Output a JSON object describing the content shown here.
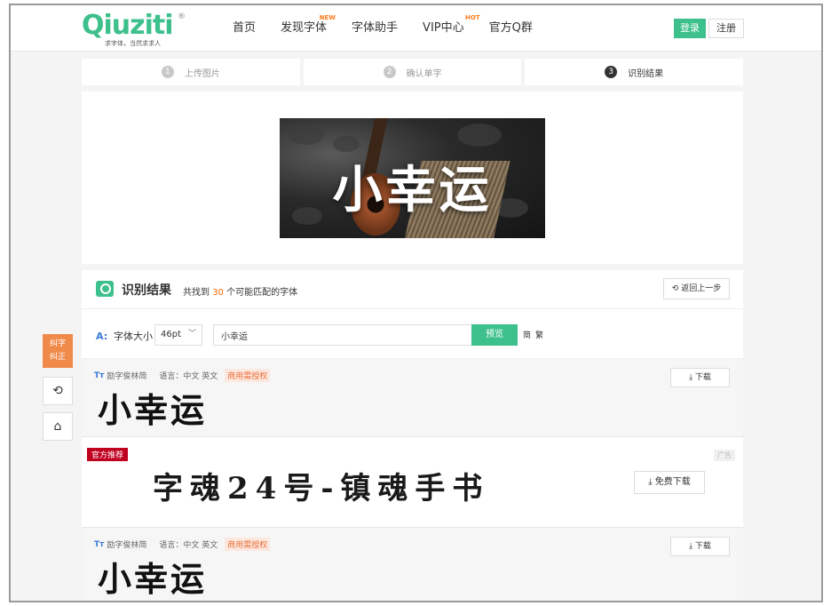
{
  "header": {
    "logo_text": "Qiuziti",
    "logo_reg": "®",
    "logo_slogan": "求字体，当然求求人",
    "nav": [
      {
        "label": "首页",
        "badge": ""
      },
      {
        "label": "发现字体",
        "badge": "NEW"
      },
      {
        "label": "字体助手",
        "badge": ""
      },
      {
        "label": "VIP中心",
        "badge": "HOT"
      },
      {
        "label": "官方Q群",
        "badge": ""
      }
    ],
    "login_label": "登录",
    "register_label": "注册"
  },
  "steps": [
    {
      "num": "1",
      "label": "上传图片"
    },
    {
      "num": "2",
      "label": "确认单字"
    },
    {
      "num": "3",
      "label": "识别结果"
    }
  ],
  "preview": {
    "text": "小幸运"
  },
  "result": {
    "title": "识别结果",
    "count_prefix": "共找到",
    "count": "30",
    "count_suffix": "个可能匹配的字体",
    "back_label": "返回上一步"
  },
  "toolbar": {
    "icon": "A:",
    "size_label": "字体大小",
    "size_value": "46pt",
    "input_value": "小幸运",
    "preview_label": "预览",
    "simp": "简",
    "trad": "繁"
  },
  "fonts": [
    {
      "icon": "Tт",
      "name": "励字俊林简",
      "lang": "语言：中文 英文",
      "license": "商用需授权",
      "sample": "小幸运",
      "download": "下载"
    },
    {
      "icon": "Tт",
      "name": "励字俊林简",
      "lang": "语言：中文 英文",
      "license": "商用需授权",
      "sample": "小幸运",
      "download": "下载"
    }
  ],
  "ad": {
    "tag": "官方推荐",
    "label": "广告",
    "text": "字魂24号-镇魂手书",
    "button": "免费下载"
  },
  "side": {
    "feedback_line1": "纠字",
    "feedback_line2": "纠正",
    "undo_icon": "⟲",
    "home_icon": "⌂"
  },
  "colors": {
    "brand": "#3ec08c",
    "accent": "#ff6a00",
    "ad_tag": "#c0001f"
  }
}
